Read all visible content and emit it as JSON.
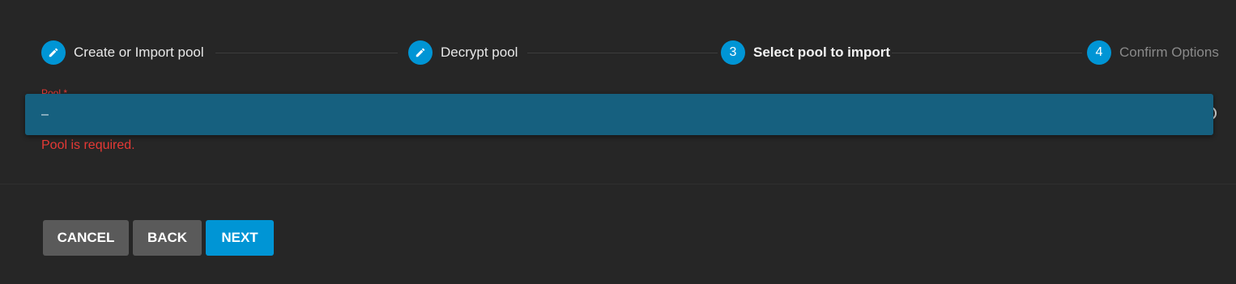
{
  "stepper": {
    "steps": [
      {
        "label": "Create or Import pool",
        "marker": "pencil-icon",
        "state": "completed"
      },
      {
        "label": "Decrypt pool",
        "marker": "pencil-icon",
        "state": "completed"
      },
      {
        "label": "Select pool to import",
        "number": "3",
        "state": "active"
      },
      {
        "label": "Confirm Options",
        "number": "4",
        "state": "pending"
      }
    ]
  },
  "form": {
    "pool": {
      "label": "Pool *",
      "value": "–",
      "error": "Pool is required."
    }
  },
  "buttons": {
    "cancel": "CANCEL",
    "back": "BACK",
    "next": "NEXT"
  },
  "colors": {
    "accent": "#0095d5",
    "error": "#e53935",
    "background": "#262626",
    "select_highlight": "#16607f",
    "secondary_button": "#5a5a5a"
  }
}
